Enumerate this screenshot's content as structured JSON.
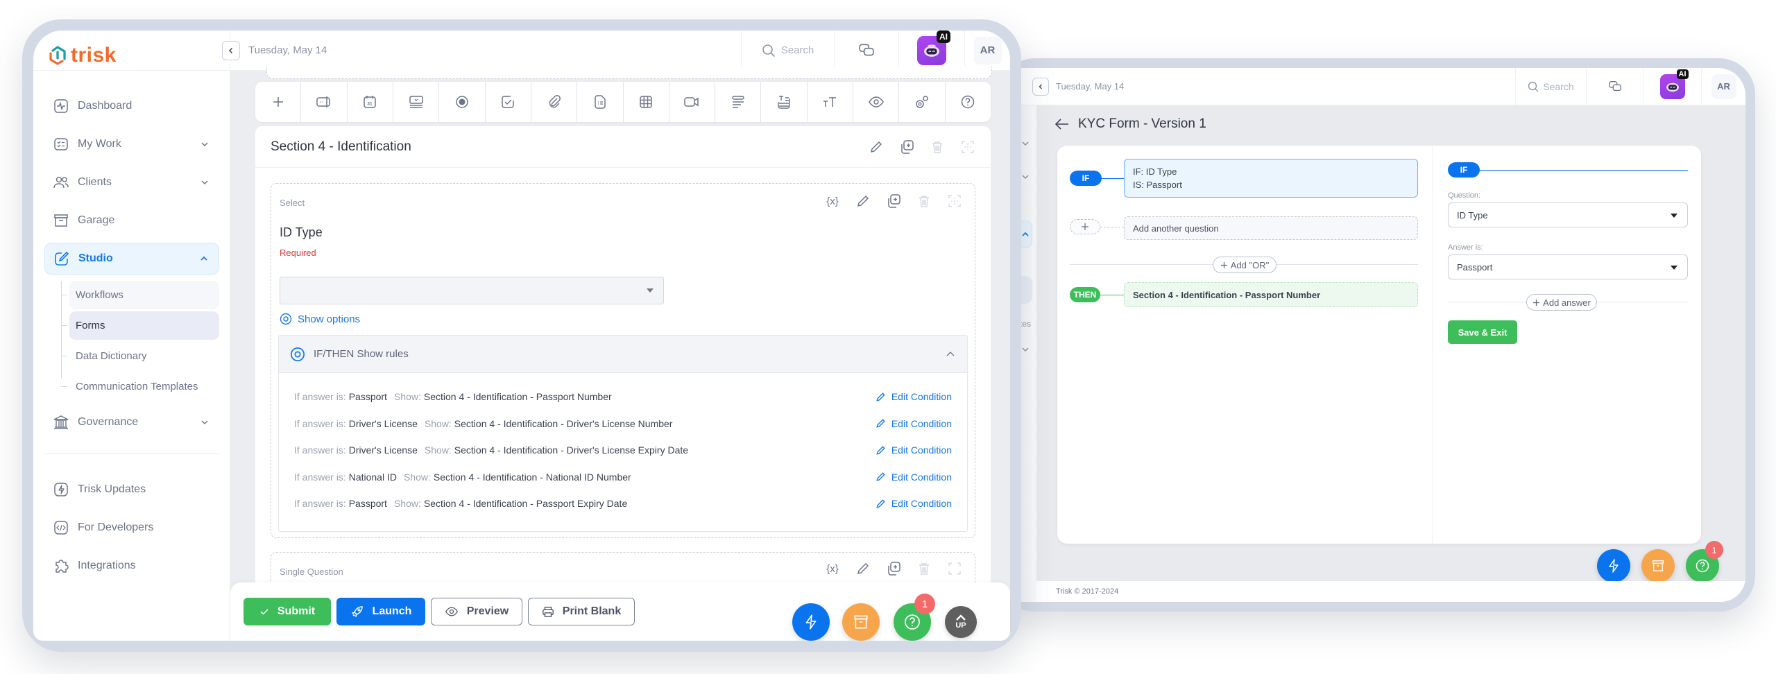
{
  "left_app": {
    "brand": "trisk",
    "topbar": {
      "date": "Tuesday, May 14",
      "search_placeholder": "Search",
      "ai_badge": "AI",
      "avatar_initials": "AR"
    },
    "sidebar": {
      "items": [
        {
          "label": "Dashboard",
          "icon": "activity-icon",
          "has_chevron": false
        },
        {
          "label": "My Work",
          "icon": "checklist-icon",
          "has_chevron": true
        },
        {
          "label": "Clients",
          "icon": "users-icon",
          "has_chevron": true
        },
        {
          "label": "Garage",
          "icon": "archive-icon",
          "has_chevron": false
        },
        {
          "label": "Studio",
          "icon": "edit-icon",
          "has_chevron": true,
          "active": true,
          "expanded": true
        }
      ],
      "studio_subitems": [
        {
          "label": "Workflows"
        },
        {
          "label": "Forms",
          "selected": true
        },
        {
          "label": "Data Dictionary"
        },
        {
          "label": "Communication Templates"
        }
      ],
      "governance": {
        "label": "Governance",
        "icon": "bank-icon"
      },
      "footer_items": [
        {
          "label": "Trisk Updates",
          "icon": "lightning-icon"
        },
        {
          "label": "For Developers",
          "icon": "code-icon"
        },
        {
          "label": "Integrations",
          "icon": "puzzle-icon"
        }
      ]
    },
    "toolbar": {
      "tools": [
        "add-icon",
        "text-input-icon",
        "calendar-icon",
        "dropdown-icon",
        "radio-icon",
        "checkbox-icon",
        "attachment-icon",
        "document-icon",
        "table-icon",
        "video-icon",
        "paragraph-icon",
        "text-block-icon",
        "font-size-icon",
        "eye-icon",
        "settings-icon",
        "help-icon"
      ],
      "calendar_day": "31"
    },
    "section": {
      "title": "Section 4 - Identification"
    },
    "question": {
      "type_label": "Select",
      "variable_glyph": "{x}",
      "label": "ID Type",
      "required_text": "Required",
      "selected_value": "",
      "show_options_label": "Show options"
    },
    "rules": {
      "header": "IF/THEN Show rules",
      "if_prefix": "If answer is:",
      "show_prefix": "Show:",
      "edit_label": "Edit Condition",
      "items": [
        {
          "answer": "Passport",
          "show": "Section 4 - Identification - Passport Number"
        },
        {
          "answer": "Driver's License",
          "show": "Section 4 - Identification - Driver's License Number"
        },
        {
          "answer": "Driver's License",
          "show": "Section 4 - Identification - Driver's License Expiry Date"
        },
        {
          "answer": "National ID",
          "show": "Section 4 - Identification - National ID Number"
        },
        {
          "answer": "Passport",
          "show": "Section 4 - Identification - Passport Expiry Date"
        }
      ]
    },
    "next_question": {
      "type_label": "Single Question"
    },
    "actions": {
      "submit": "Submit",
      "launch": "Launch",
      "preview": "Preview",
      "print_blank": "Print Blank"
    },
    "fabs": {
      "help_badge": "1",
      "up_label": "UP"
    }
  },
  "right_app": {
    "topbar": {
      "date": "Tuesday, May 14",
      "search_placeholder": "Search",
      "ai_badge": "AI",
      "avatar_initials": "AR"
    },
    "sidebar_ghost": {
      "partial_label": "plates"
    },
    "page_title": "KYC Form - Version 1",
    "builder": {
      "if_pill": "IF",
      "if_question_line": "IF: ID Type",
      "if_answer_line": "IS: Passport",
      "add_question_label": "Add another question",
      "add_or_label": "Add \"OR\"",
      "then_pill": "THEN",
      "then_target": "Section 4 - Identification - Passport Number"
    },
    "editor": {
      "if_pill": "IF",
      "question_label": "Question:",
      "question_value": "ID Type",
      "answer_label": "Answer is:",
      "answer_value": "Passport",
      "add_answer_label": "Add answer",
      "save_exit_label": "Save & Exit"
    },
    "fabs": {
      "help_badge": "1"
    },
    "footer": "Trisk © 2017-2024"
  },
  "colors": {
    "brand_orange": "#f26b2a",
    "brand_teal": "#1a9c9c",
    "primary_blue": "#0a73ee",
    "success_green": "#3dbe5a",
    "warning_orange": "#f7a54a",
    "danger_red": "#e53935",
    "badge_red": "#f36a6a",
    "frame": "#d3dae6"
  }
}
